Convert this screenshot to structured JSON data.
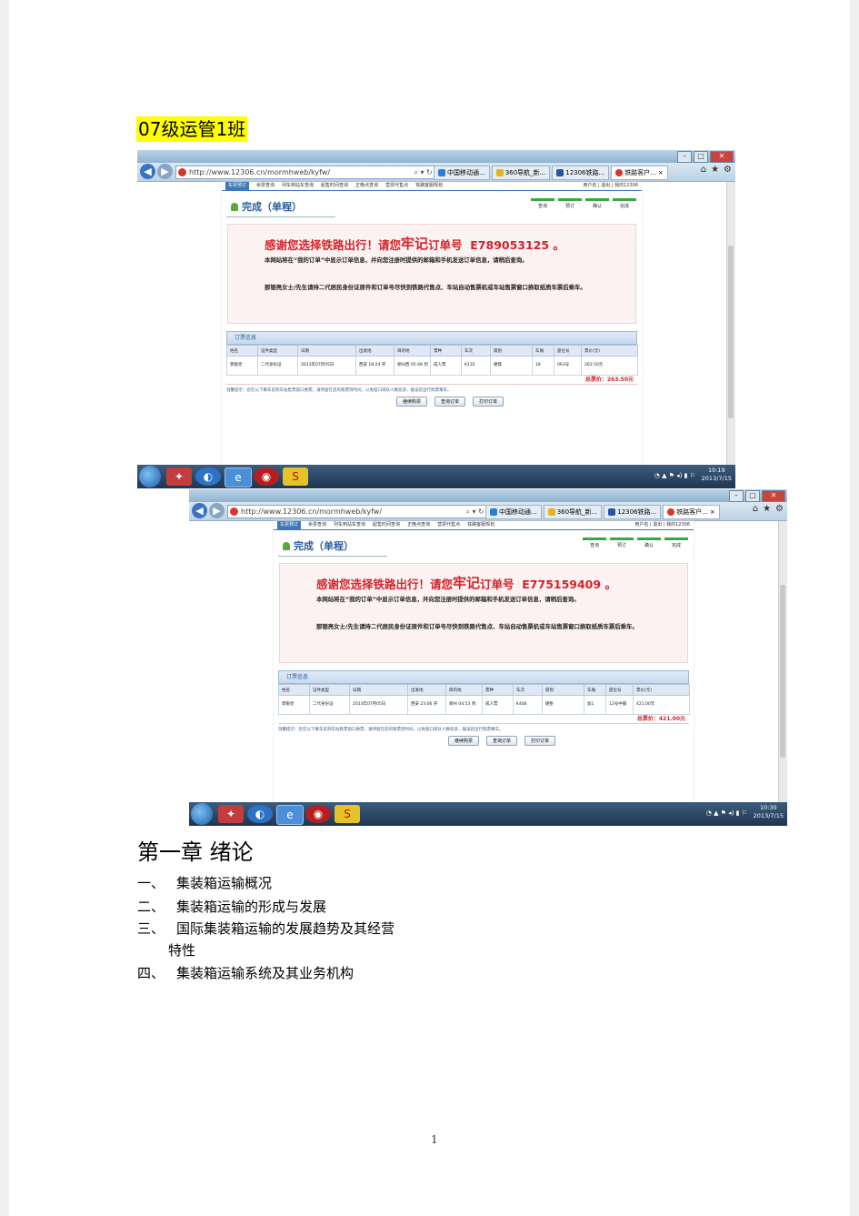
{
  "header": {
    "class_title": "07级运管1班"
  },
  "screenshots": [
    {
      "address": "http://www.12306.cn/mormhweb/kyfw/",
      "tabs": [
        "中国移动通...",
        "360导航_新...",
        "12306铁路...",
        "铁路客户..."
      ],
      "menu": [
        "车票预订",
        "余票查询",
        "列车到站车查询",
        "起售时间查询",
        "正晚点查询",
        "营票代售点",
        "铁路客服规划"
      ],
      "user": [
        "用户名",
        "退出",
        "我的12306"
      ],
      "done_title": "完成（单程）",
      "steps": [
        "查询",
        "预订",
        "确认",
        "完成"
      ],
      "thanks": {
        "pre": "感谢您选择铁路出行！请您",
        "mark": "牢记",
        "order_label": "订单号",
        "order_no": "E789053125",
        "end": "。"
      },
      "msg1": "本网站将在“我的订单”中显示订单信息，并向您注册时提供的邮箱和手机发送订单信息，请稍后查询。",
      "msg2": "那银亮女士/先生请持二代居民身份证原件和订单号尽快到铁路代售点、车站自动售票机或车站售票窗口换取纸质车票后乘车。",
      "info_header": "订票信息",
      "columns": [
        "姓名",
        "证件类型",
        "日期",
        "出发地",
        "目的地",
        "票种",
        "车次",
        "席别",
        "车厢",
        "座位号",
        "票价(元)"
      ],
      "row": [
        "郭银亮",
        "二代身份证",
        "2013年07月05日",
        "西安 18:24 开",
        "郑州西 05:48 到",
        "成人票",
        "K132",
        "硬座",
        "18",
        "063号",
        "263.50元"
      ],
      "total": "总票价：263.50元",
      "tip": "温馨提示：您在以下乘车前到车站售票窗口换票；请持留在您的铁票到时间，以免窗口排队人数较多，耽误您出行购票乘车。",
      "buttons": [
        "继续购票",
        "查询订单",
        "打印订单"
      ],
      "time": "10:19",
      "date": "2013/7/15"
    },
    {
      "address": "http://www.12306.cn/mormhweb/kyfw/",
      "tabs": [
        "中国移动通...",
        "360导航_新...",
        "12306铁路...",
        "铁路客户..."
      ],
      "menu": [
        "车票预订",
        "余票查询",
        "列车到站车查询",
        "起售时间查询",
        "正晚点查询",
        "营票代售点",
        "铁路客服规划"
      ],
      "user": [
        "用户名",
        "退出",
        "我的12306"
      ],
      "done_title": "完成（单程）",
      "steps": [
        "查询",
        "预订",
        "确认",
        "完成"
      ],
      "thanks": {
        "pre": "感谢您选择铁路出行！请您",
        "mark": "牢记",
        "order_label": "订单号",
        "order_no": "E775159409",
        "end": "。"
      },
      "msg1": "本网站将在“我的订单”中显示订单信息，并向您注册时提供的邮箱和手机发送订单信息，请稍后查询。",
      "msg2": "那银亮女士/先生请持二代居民身份证原件和订单号尽快到铁路代售点、车站自动售票机或车站售票窗口换取纸质车票后乘车。",
      "info_header": "订票信息",
      "columns": [
        "姓名",
        "证件类型",
        "日期",
        "出发地",
        "目的地",
        "票种",
        "车次",
        "席别",
        "车厢",
        "座位号",
        "票价(元)"
      ],
      "row": [
        "郭银亮",
        "二代身份证",
        "2013年07月05日",
        "西安 23:06 开",
        "郑州 04:53 到",
        "成人票",
        "K448",
        "硬卧",
        "加1",
        "12号中铺",
        "421.00元"
      ],
      "total": "总票价：421.00元",
      "tip": "温馨提示：您在以下乘车前到车站售票窗口换票；请持留在您的铁票到时间，以免窗口排队人数较多，耽误您出行购票乘车。",
      "buttons": [
        "继续购票",
        "查询订单",
        "打印订单"
      ],
      "time": "10:30",
      "date": "2013/7/15"
    }
  ],
  "chapter": {
    "title": "第一章  绪论",
    "items": [
      {
        "num": "一、",
        "text": "集装箱运输概况"
      },
      {
        "num": "二、",
        "text": "集装箱运输的形成与发展"
      },
      {
        "num": "三、",
        "text": "国际集装箱运输的发展趋势及其经营"
      },
      {
        "num": "",
        "text": "特性"
      },
      {
        "num": "四、",
        "text": "集装箱运输系统及其业务机构"
      }
    ]
  },
  "page_number": "1"
}
